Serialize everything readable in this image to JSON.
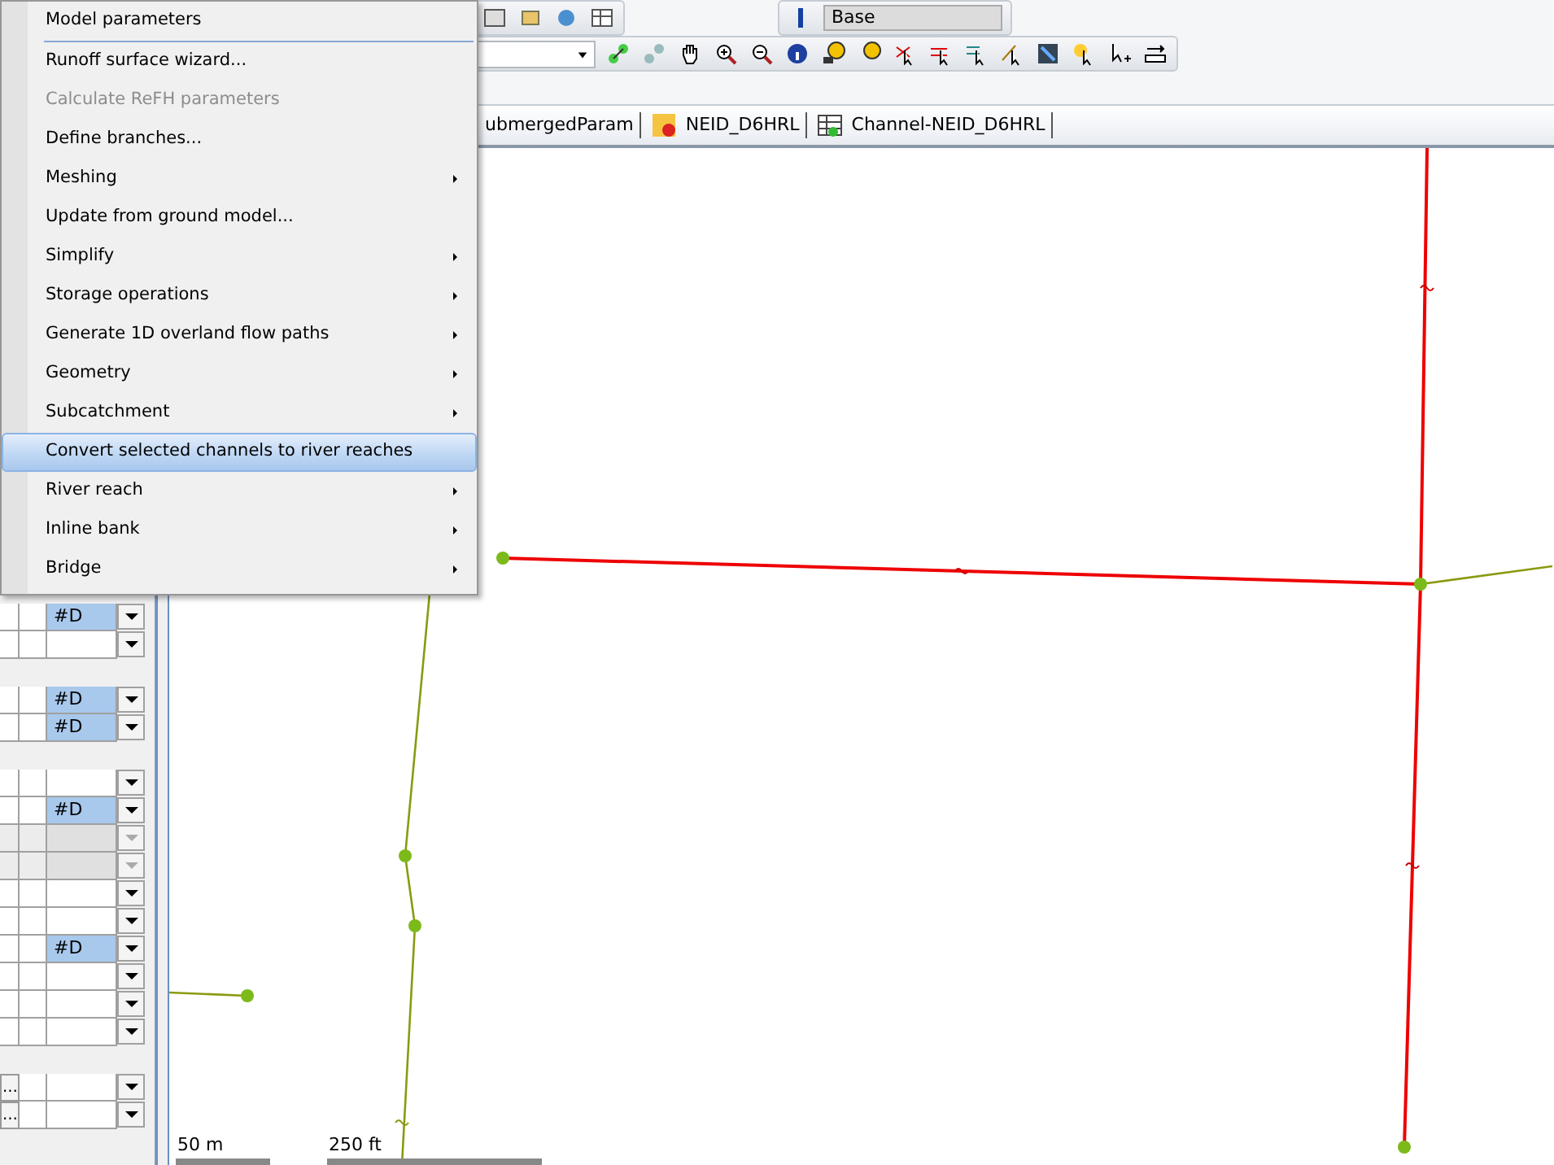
{
  "context_menu": {
    "items": [
      {
        "label": "Model parameters",
        "disabled": false,
        "submenu": false,
        "selected": false
      },
      {
        "label": "Runoff surface wizard...",
        "disabled": false,
        "submenu": false,
        "selected": false
      },
      {
        "label": "Calculate ReFH parameters",
        "disabled": true,
        "submenu": false,
        "selected": false
      },
      {
        "label": "Define branches...",
        "disabled": false,
        "submenu": false,
        "selected": false
      },
      {
        "label": "Meshing",
        "disabled": false,
        "submenu": true,
        "selected": false
      },
      {
        "label": "Update from ground model...",
        "disabled": false,
        "submenu": false,
        "selected": false
      },
      {
        "label": "Simplify",
        "disabled": false,
        "submenu": true,
        "selected": false
      },
      {
        "label": "Storage operations",
        "disabled": false,
        "submenu": true,
        "selected": false
      },
      {
        "label": "Generate 1D overland flow paths",
        "disabled": false,
        "submenu": true,
        "selected": false
      },
      {
        "label": "Geometry",
        "disabled": false,
        "submenu": true,
        "selected": false
      },
      {
        "label": "Subcatchment",
        "disabled": false,
        "submenu": true,
        "selected": false
      },
      {
        "label": "Convert selected channels to river reaches",
        "disabled": false,
        "submenu": false,
        "selected": true
      },
      {
        "label": "River reach",
        "disabled": false,
        "submenu": true,
        "selected": false
      },
      {
        "label": "Inline bank",
        "disabled": false,
        "submenu": true,
        "selected": false
      },
      {
        "label": "Bridge",
        "disabled": false,
        "submenu": true,
        "selected": false
      }
    ]
  },
  "toolbar": {
    "scenario_field": "Base"
  },
  "tabs": [
    {
      "label": "ubmergedParam",
      "selected": false
    },
    {
      "label": "NEID_D6HRL",
      "selected": false
    },
    {
      "label": "Channel-NEID_D6HRL",
      "selected": false
    }
  ],
  "property_grid": {
    "groups": [
      {
        "rows": [
          {
            "value": "#D",
            "selected": true,
            "disabled": false,
            "kind": "plain"
          },
          {
            "value": "",
            "selected": false,
            "disabled": false,
            "kind": "plain"
          }
        ]
      },
      {
        "rows": [
          {
            "value": "#D",
            "selected": true,
            "disabled": false,
            "kind": "plain"
          },
          {
            "value": "#D",
            "selected": true,
            "disabled": false,
            "kind": "plain"
          }
        ]
      },
      {
        "rows": [
          {
            "value": "",
            "selected": false,
            "disabled": false,
            "kind": "plain"
          },
          {
            "value": "#D",
            "selected": true,
            "disabled": false,
            "kind": "plain"
          },
          {
            "value": "",
            "selected": false,
            "disabled": true,
            "kind": "plain"
          },
          {
            "value": "",
            "selected": false,
            "disabled": true,
            "kind": "plain"
          },
          {
            "value": "",
            "selected": false,
            "disabled": false,
            "kind": "plain"
          },
          {
            "value": "",
            "selected": false,
            "disabled": false,
            "kind": "plain"
          },
          {
            "value": "#D",
            "selected": true,
            "disabled": false,
            "kind": "plain"
          },
          {
            "value": "",
            "selected": false,
            "disabled": false,
            "kind": "plain"
          },
          {
            "value": "",
            "selected": false,
            "disabled": false,
            "kind": "plain"
          },
          {
            "value": "",
            "selected": false,
            "disabled": false,
            "kind": "plain"
          }
        ]
      },
      {
        "rows": [
          {
            "value": "",
            "selected": false,
            "disabled": false,
            "kind": "ellipsis",
            "button": "..."
          },
          {
            "value": "",
            "selected": false,
            "disabled": false,
            "kind": "ellipsis",
            "button": "..."
          }
        ]
      }
    ]
  },
  "map": {
    "scale_bars": [
      {
        "label": "50 m"
      },
      {
        "label": "250 ft"
      }
    ]
  }
}
